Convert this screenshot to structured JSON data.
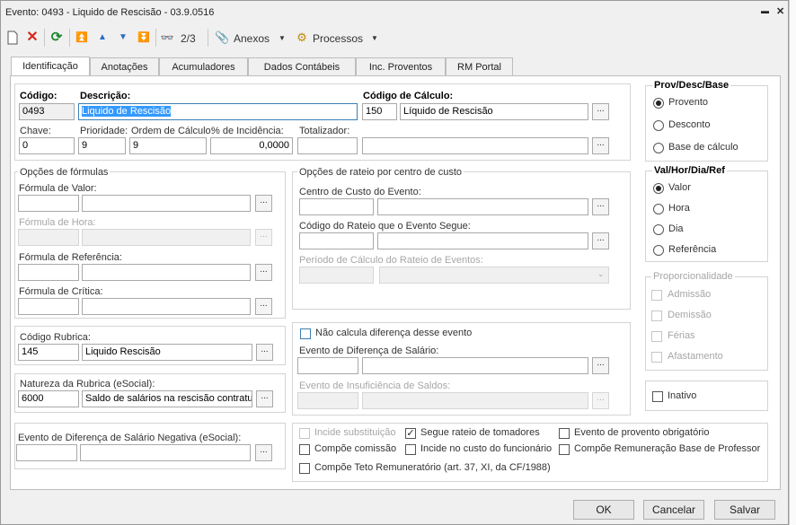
{
  "window": {
    "title": "Evento: 0493 - Liquido de Rescisão - 03.9.0516",
    "minimize": "▬",
    "close": "✕"
  },
  "toolbar": {
    "page_indicator": "2/3",
    "attachments_label": "Anexos",
    "processes_label": "Processos",
    "dropdown_arrow": "▼"
  },
  "tabs": [
    "Identificação",
    "Anotações",
    "Acumuladores",
    "Dados Contábeis",
    "Inc. Proventos",
    "RM Portal"
  ],
  "ellipsis": "...",
  "main": {
    "codigo_label": "Código:",
    "codigo_value": "0493",
    "descricao_label": "Descrição:",
    "descricao_value": "Liquido de Rescisão",
    "codigo_calculo_label": "Código de Cálculo:",
    "codigo_calculo_value": "150",
    "codigo_calculo_desc": "Líquido de Rescisão",
    "chave_label": "Chave:",
    "chave_value": "0",
    "prioridade_label": "Prioridade:",
    "prioridade_value": "9",
    "ordem_label": "Ordem de Cálculo:",
    "ordem_value": "9",
    "incidencia_label": "% de Incidência:",
    "incidencia_value": "0,0000",
    "totalizador_label": "Totalizador:"
  },
  "formulas": {
    "title": "Opções de fórmulas",
    "valor_label": "Fórmula de Valor:",
    "hora_label": "Fórmula de Hora:",
    "referencia_label": "Fórmula de Referência:",
    "critica_label": "Fórmula de Crítica:"
  },
  "rateio": {
    "title": "Opções de rateio por centro de custo",
    "centro_label": "Centro de Custo do Evento:",
    "rateio_label": "Código do Rateio que o Evento Segue:",
    "periodo_label": "Período de Cálculo do Rateio de Eventos:"
  },
  "rubrica": {
    "label": "Código Rubrica:",
    "code": "145",
    "desc": "Liquido Rescisão"
  },
  "natureza": {
    "label": "Natureza da Rubrica (eSocial):",
    "code": "6000",
    "desc": "Saldo de salários na rescisão contratual"
  },
  "diferenca": {
    "nao_calcula_label": "Não calcula diferença desse evento",
    "salario_label": "Evento de Diferença de Salário:",
    "insuficiencia_label": "Evento de Insuficiência de Saldos:"
  },
  "negativa_label": "Evento de Diferença de Salário Negativa (eSocial):",
  "prov": {
    "title": "Prov/Desc/Base",
    "options": [
      "Provento",
      "Desconto",
      "Base de cálculo"
    ],
    "selected": "Provento"
  },
  "valhor": {
    "title": "Val/Hor/Dia/Ref",
    "options": [
      "Valor",
      "Hora",
      "Dia",
      "Referência"
    ],
    "selected": "Valor"
  },
  "proporcionalidade": {
    "title": "Proporcionalidade",
    "options": [
      "Admissão",
      "Demissão",
      "Férias",
      "Afastamento"
    ]
  },
  "inativo_label": "Inativo",
  "bottom_checks": {
    "incide_substituicao": "Incide substituição",
    "segue_rateio": "Segue rateio de tomadores",
    "provento_obrigatorio": "Evento de provento obrigatório",
    "compoe_comissao": "Compõe comissão",
    "incide_custo": "Incide no custo do funcionário",
    "compoe_remuneracao": "Compõe Remuneração Base de Professor",
    "compoe_teto": "Compõe Teto Remuneratório (art. 37, XI, da CF/1988)",
    "checkmark": "✓"
  },
  "footer": {
    "ok": "OK",
    "cancel": "Cancelar",
    "save": "Salvar"
  }
}
